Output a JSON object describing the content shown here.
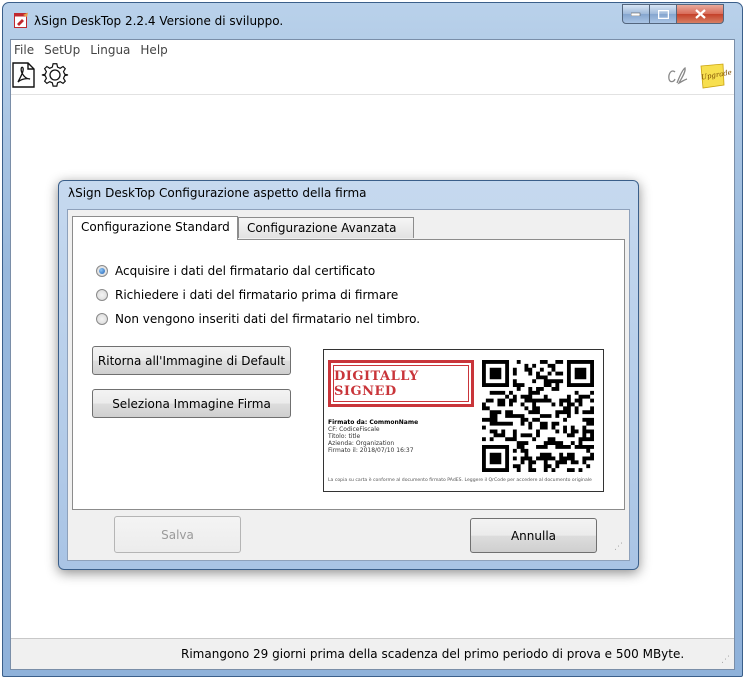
{
  "window": {
    "title": "λSign DeskTop  2.2.4 Versione di sviluppo.",
    "controls": {
      "minimize": "—",
      "maximize": "☐",
      "close": "✕"
    }
  },
  "menu": [
    "File",
    "SetUp",
    "Lingua",
    "Help"
  ],
  "toolbar": {
    "left_icons": [
      "pdf-icon",
      "gear-icon"
    ],
    "right_icons": [
      "signature-icon",
      "sticky-note-icon"
    ],
    "sticky_note_text": "Upgrade"
  },
  "status_bar": {
    "text": "Rimangono 29 giorni prima della scadenza del primo periodo di prova e 500 MByte."
  },
  "dialog": {
    "title": "λSign DeskTop Configurazione aspetto della firma",
    "tabs": [
      {
        "label": "Configurazione Standard",
        "active": true
      },
      {
        "label": "Configurazione Avanzata",
        "active": false
      }
    ],
    "radios": [
      {
        "label": "Acquisire i dati del firmatario dal certificato",
        "checked": true
      },
      {
        "label": "Richiedere i dati del firmatario prima di firmare",
        "checked": false
      },
      {
        "label": "Non vengono inseriti dati del firmatario nel timbro.",
        "checked": false
      }
    ],
    "buttons": {
      "default_image": "Ritorna all'Immagine di Default",
      "select_image": "Seleziona Immagine Firma",
      "save": "Salva",
      "cancel": "Annulla"
    },
    "preview": {
      "stamp_text": "DIGITALLY SIGNED",
      "signed_by": "Firmato da: CommonName",
      "lines": [
        "CF: CodiceFiscale",
        "Titolo: title",
        "Azienda: Organization",
        "Firmato il: 2018/07/10 16:37"
      ],
      "note": "La copia su carta è conforme al documento firmato PAdES. Leggere il QrCode per accedere al documento originale"
    }
  },
  "colors": {
    "frame": "#98b8dc",
    "stamp_red": "#c9353a",
    "radio_blue": "#1f5fb4"
  }
}
